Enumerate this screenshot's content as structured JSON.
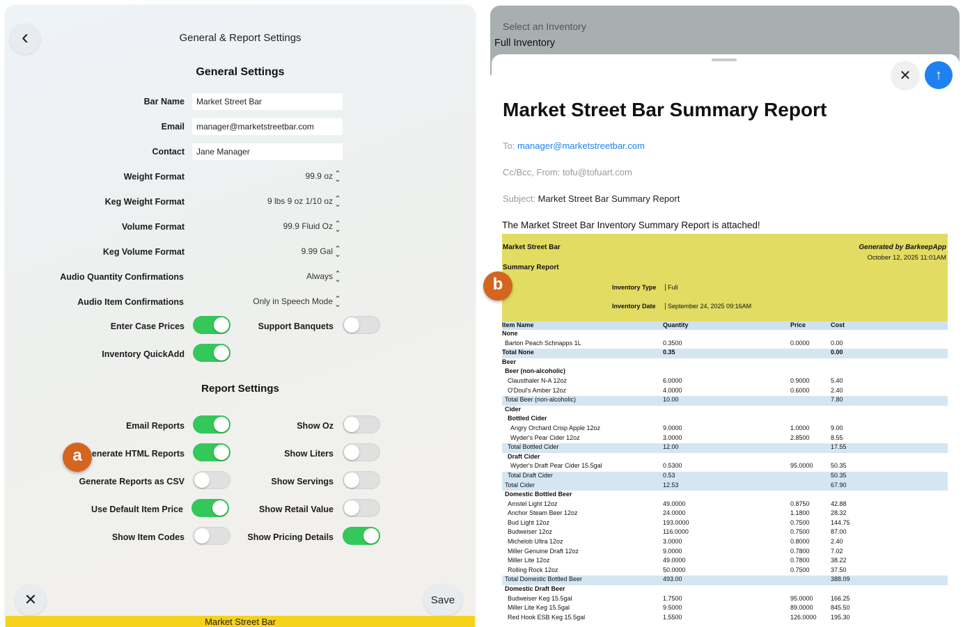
{
  "settings": {
    "nav_title": "General & Report Settings",
    "back_icon": "‹",
    "general_title": "General Settings",
    "report_title": "Report Settings",
    "save_label": "Save",
    "close_icon": "✕",
    "bottom_bar": "Market Street Bar",
    "fields": [
      {
        "label": "Bar Name",
        "value": "Market Street Bar"
      },
      {
        "label": "Email",
        "value": "manager@marketstreetbar.com"
      },
      {
        "label": "Contact",
        "value": "Jane Manager"
      }
    ],
    "pickers": [
      {
        "label": "Weight Format",
        "value": "99.9 oz"
      },
      {
        "label": "Keg Weight Format",
        "value": "9 lbs 9 oz 1/10 oz"
      },
      {
        "label": "Volume Format",
        "value": "99.9 Fluid Oz"
      },
      {
        "label": "Keg Volume Format",
        "value": "9.99 Gal"
      },
      {
        "label": "Audio Quantity Confirmations",
        "value": "Always"
      },
      {
        "label": "Audio Item Confirmations",
        "value": "Only in Speech Mode"
      }
    ],
    "general_toggles": {
      "enter_case_prices": {
        "label": "Enter Case Prices",
        "on": true
      },
      "support_banquets": {
        "label": "Support Banquets",
        "on": false
      },
      "inventory_quickadd": {
        "label": "Inventory QuickAdd",
        "on": true
      }
    },
    "report_toggles_left": [
      {
        "label": "Email Reports",
        "on": true
      },
      {
        "label": "Generate HTML Reports",
        "on": true
      },
      {
        "label": "Generate Reports as CSV",
        "on": false
      },
      {
        "label": "Use Default Item Price",
        "on": true
      },
      {
        "label": "Show Item Codes",
        "on": false
      }
    ],
    "report_toggles_right": [
      {
        "label": "Show Oz",
        "on": false
      },
      {
        "label": "Show Liters",
        "on": false
      },
      {
        "label": "Show Servings",
        "on": false
      },
      {
        "label": "Show Retail Value",
        "on": false
      },
      {
        "label": "Show Pricing Details",
        "on": true
      }
    ],
    "colors": {
      "toggle_on": "#34c759",
      "toggle_off": "#e0e0e0",
      "bottom_bar": "#f5d21c"
    }
  },
  "callouts": {
    "a": "a",
    "b": "b",
    "color": "#d4651f"
  },
  "email": {
    "select_inventory": "Select an Inventory",
    "full_inventory": "Full Inventory",
    "close_icon": "✕",
    "send_icon": "↑",
    "title": "Market Street Bar Summary Report",
    "to_label": "To:",
    "to_value": "manager@marketstreetbar.com",
    "cc_line": "Cc/Bcc, From: tofu@tofuart.com",
    "subject_label": "Subject:",
    "subject_value": "Market Street Bar Summary Report",
    "body": "The Market Street Bar Inventory Summary Report is attached!",
    "report_header": {
      "bar_name": "Market Street Bar",
      "report_name": "Summary Report",
      "generated_by": "Generated by BarkeepApp",
      "generated_date": "October 12, 2025 11:01AM",
      "inventory_type_label": "Inventory Type",
      "inventory_type_value": "Full",
      "inventory_date_label": "Inventory Date",
      "inventory_date_value": "September 24, 2025 09:16AM",
      "color": "#e3dc63"
    },
    "columns": [
      "Item Name",
      "Quantity",
      "Price",
      "Cost"
    ],
    "rows": [
      {
        "name": "None",
        "qty": "",
        "price": "",
        "cost": "",
        "indent": 0,
        "bold": true,
        "shade": false
      },
      {
        "name": "Barton Peach Schnapps 1L",
        "qty": "0.3500",
        "price": "0.0000",
        "cost": "0.00",
        "indent": 1,
        "bold": false,
        "shade": false
      },
      {
        "name": "Total None",
        "qty": "0.35",
        "price": "",
        "cost": "0.00",
        "indent": 0,
        "bold": true,
        "shade": true
      },
      {
        "name": "Beer",
        "qty": "",
        "price": "",
        "cost": "",
        "indent": 0,
        "bold": true,
        "shade": false
      },
      {
        "name": "Beer (non-alcoholic)",
        "qty": "",
        "price": "",
        "cost": "",
        "indent": 1,
        "bold": true,
        "shade": false
      },
      {
        "name": "Clausthaler N-A 12oz",
        "qty": "6.0000",
        "price": "0.9000",
        "cost": "5.40",
        "indent": 2,
        "bold": false,
        "shade": false
      },
      {
        "name": "O'Doul's Amber 12oz",
        "qty": "4.0000",
        "price": "0.6000",
        "cost": "2.40",
        "indent": 2,
        "bold": false,
        "shade": false
      },
      {
        "name": "Total Beer (non-alcoholic)",
        "qty": "10.00",
        "price": "",
        "cost": "7.80",
        "indent": 1,
        "bold": false,
        "shade": true
      },
      {
        "name": "Cider",
        "qty": "",
        "price": "",
        "cost": "",
        "indent": 1,
        "bold": true,
        "shade": false
      },
      {
        "name": "Bottled Cider",
        "qty": "",
        "price": "",
        "cost": "",
        "indent": 2,
        "bold": true,
        "shade": false
      },
      {
        "name": "Angry Orchard Crisp Apple 12oz",
        "qty": "9.0000",
        "price": "1.0000",
        "cost": "9.00",
        "indent": 3,
        "bold": false,
        "shade": false
      },
      {
        "name": "Wyder's Pear Cider 12oz",
        "qty": "3.0000",
        "price": "2.8500",
        "cost": "8.55",
        "indent": 3,
        "bold": false,
        "shade": false
      },
      {
        "name": "Total Bottled Cider",
        "qty": "12.00",
        "price": "",
        "cost": "17.55",
        "indent": 2,
        "bold": false,
        "shade": true
      },
      {
        "name": "Draft Cider",
        "qty": "",
        "price": "",
        "cost": "",
        "indent": 2,
        "bold": true,
        "shade": false
      },
      {
        "name": "Wyder's Draft Pear Cider 15.5gal",
        "qty": "0.5300",
        "price": "95.0000",
        "cost": "50.35",
        "indent": 3,
        "bold": false,
        "shade": false
      },
      {
        "name": "Total Draft Cider",
        "qty": "0.53",
        "price": "",
        "cost": "50.35",
        "indent": 2,
        "bold": false,
        "shade": true
      },
      {
        "name": "Total Cider",
        "qty": "12.53",
        "price": "",
        "cost": "67.90",
        "indent": 1,
        "bold": false,
        "shade": true
      },
      {
        "name": "Domestic Bottled Beer",
        "qty": "",
        "price": "",
        "cost": "",
        "indent": 1,
        "bold": true,
        "shade": false
      },
      {
        "name": "Amstel Light 12oz",
        "qty": "49.0000",
        "price": "0.8750",
        "cost": "42.88",
        "indent": 2,
        "bold": false,
        "shade": false
      },
      {
        "name": "Anchor Steam Beer 12oz",
        "qty": "24.0000",
        "price": "1.1800",
        "cost": "28.32",
        "indent": 2,
        "bold": false,
        "shade": false
      },
      {
        "name": "Bud Light 12oz",
        "qty": "193.0000",
        "price": "0.7500",
        "cost": "144.75",
        "indent": 2,
        "bold": false,
        "shade": false
      },
      {
        "name": "Budweiser 12oz",
        "qty": "116.0000",
        "price": "0.7500",
        "cost": "87.00",
        "indent": 2,
        "bold": false,
        "shade": false
      },
      {
        "name": "Michelob Ultra 12oz",
        "qty": "3.0000",
        "price": "0.8000",
        "cost": "2.40",
        "indent": 2,
        "bold": false,
        "shade": false
      },
      {
        "name": "Miller Genuine Draft 12oz",
        "qty": "9.0000",
        "price": "0.7800",
        "cost": "7.02",
        "indent": 2,
        "bold": false,
        "shade": false
      },
      {
        "name": "Miller Lite 12oz",
        "qty": "49.0000",
        "price": "0.7800",
        "cost": "38.22",
        "indent": 2,
        "bold": false,
        "shade": false
      },
      {
        "name": "Rolling Rock 12oz",
        "qty": "50.0000",
        "price": "0.7500",
        "cost": "37.50",
        "indent": 2,
        "bold": false,
        "shade": false
      },
      {
        "name": "Total Domestic Bottled Beer",
        "qty": "493.00",
        "price": "",
        "cost": "388.09",
        "indent": 1,
        "bold": false,
        "shade": true
      },
      {
        "name": "Domestic Draft Beer",
        "qty": "",
        "price": "",
        "cost": "",
        "indent": 1,
        "bold": true,
        "shade": false
      },
      {
        "name": "Budweiser Keg 15.5gal",
        "qty": "1.7500",
        "price": "95.0000",
        "cost": "166.25",
        "indent": 2,
        "bold": false,
        "shade": false
      },
      {
        "name": "Miller Lite Keg 15.5gal",
        "qty": "9.5000",
        "price": "89.0000",
        "cost": "845.50",
        "indent": 2,
        "bold": false,
        "shade": false
      },
      {
        "name": "Red Hook ESB Keg 15.5gal",
        "qty": "1.5500",
        "price": "126.0000",
        "cost": "195.30",
        "indent": 2,
        "bold": false,
        "shade": false
      }
    ]
  }
}
